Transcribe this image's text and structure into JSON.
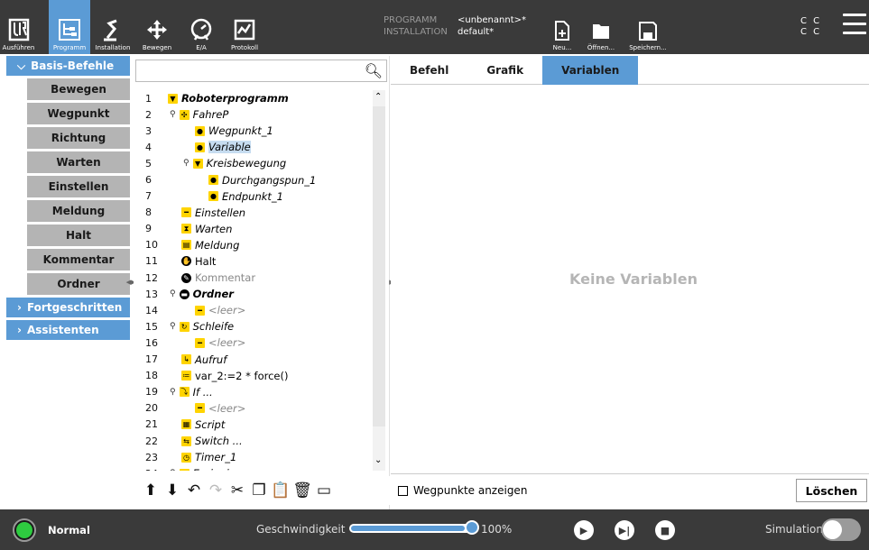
{
  "header": {
    "nav": [
      {
        "label": "Ausführen",
        "icon": "ur-logo-icon",
        "active": false
      },
      {
        "label": "Programm",
        "icon": "program-tree-icon",
        "active": true
      },
      {
        "label": "Installation",
        "icon": "robot-arm-icon",
        "active": false
      },
      {
        "label": "Bewegen",
        "icon": "move-arrows-icon",
        "active": false
      },
      {
        "label": "E/A",
        "icon": "io-gauge-icon",
        "active": false
      },
      {
        "label": "Protokoll",
        "icon": "log-graph-icon",
        "active": false
      }
    ],
    "program_key": "PROGRAMM",
    "program_value": "<unbenannt>*",
    "install_key": "INSTALLATION",
    "install_value": "default*",
    "file_buttons": [
      {
        "label": "Neu...",
        "icon": "new-file-icon"
      },
      {
        "label": "Öffnen...",
        "icon": "open-folder-icon"
      },
      {
        "label": "Speichern...",
        "icon": "save-disk-icon"
      }
    ],
    "cc_top": "C C",
    "cc_bottom": "C C"
  },
  "left": {
    "basic_section": "Basis-Befehle",
    "basic_items": [
      "Bewegen",
      "Wegpunkt",
      "Richtung",
      "Warten",
      "Einstellen",
      "Meldung",
      "Halt",
      "Kommentar",
      "Ordner"
    ],
    "advanced_section": "Fortgeschritten",
    "assistant_section": "Assistenten"
  },
  "tree": {
    "search_placeholder": "",
    "rows": [
      {
        "n": "1",
        "text": "Roboterprogramm",
        "style": "bold",
        "icon": "▼",
        "ic": "y",
        "indent": 0,
        "pin": false
      },
      {
        "n": "2",
        "text": "FahreP",
        "style": "it",
        "icon": "✣",
        "ic": "y",
        "indent": 1,
        "pin": true
      },
      {
        "n": "3",
        "text": "Wegpunkt_1",
        "style": "it",
        "icon": "●",
        "ic": "y",
        "indent": 2,
        "pin": false
      },
      {
        "n": "4",
        "text": "Variable",
        "style": "it sel",
        "icon": "●",
        "ic": "y",
        "indent": 2,
        "pin": false
      },
      {
        "n": "5",
        "text": "Kreisbewegung",
        "style": "it",
        "icon": "▼",
        "ic": "y",
        "indent": 2,
        "pin": true
      },
      {
        "n": "6",
        "text": "Durchgangspun_1",
        "style": "it",
        "icon": "●",
        "ic": "y",
        "indent": 3,
        "pin": false
      },
      {
        "n": "7",
        "text": "Endpunkt_1",
        "style": "it",
        "icon": "●",
        "ic": "y",
        "indent": 3,
        "pin": false
      },
      {
        "n": "8",
        "text": "Einstellen",
        "style": "it",
        "icon": "━",
        "ic": "y",
        "indent": 1,
        "pin": false
      },
      {
        "n": "9",
        "text": "Warten",
        "style": "it",
        "icon": "⧗",
        "ic": "y",
        "indent": 1,
        "pin": false
      },
      {
        "n": "10",
        "text": "Meldung",
        "style": "it",
        "icon": "▤",
        "ic": "y",
        "indent": 1,
        "pin": false
      },
      {
        "n": "11",
        "text": "Halt",
        "style": "",
        "icon": "✋",
        "ic": "k",
        "indent": 1,
        "pin": false
      },
      {
        "n": "12",
        "text": "Kommentar",
        "style": "gray",
        "icon": "✎",
        "ic": "k",
        "indent": 1,
        "pin": false
      },
      {
        "n": "13",
        "text": "Ordner",
        "style": "bold",
        "icon": "▬",
        "ic": "k",
        "indent": 1,
        "pin": true
      },
      {
        "n": "14",
        "text": "<leer>",
        "style": "it gray",
        "icon": "━",
        "ic": "y",
        "indent": 2,
        "pin": false
      },
      {
        "n": "15",
        "text": "Schleife",
        "style": "it",
        "icon": "↻",
        "ic": "y",
        "indent": 1,
        "pin": true
      },
      {
        "n": "16",
        "text": "<leer>",
        "style": "it gray",
        "icon": "━",
        "ic": "y",
        "indent": 2,
        "pin": false
      },
      {
        "n": "17",
        "text": "Aufruf",
        "style": "it",
        "icon": "↳",
        "ic": "y",
        "indent": 1,
        "pin": false
      },
      {
        "n": "18",
        "text": "var_2:=2 * force()",
        "style": "",
        "icon": "≔",
        "ic": "y",
        "indent": 1,
        "pin": false
      },
      {
        "n": "19",
        "text": "If ...",
        "style": "it",
        "icon": "⤵",
        "ic": "y",
        "indent": 1,
        "pin": true
      },
      {
        "n": "20",
        "text": "<leer>",
        "style": "it gray",
        "icon": "━",
        "ic": "y",
        "indent": 2,
        "pin": false
      },
      {
        "n": "21",
        "text": "Script",
        "style": "it",
        "icon": "▦",
        "ic": "y",
        "indent": 1,
        "pin": false
      },
      {
        "n": "22",
        "text": "Switch ...",
        "style": "it",
        "icon": "⇆",
        "ic": "y",
        "indent": 1,
        "pin": false
      },
      {
        "n": "23",
        "text": "Timer_1",
        "style": "it",
        "icon": "◷",
        "ic": "y",
        "indent": 1,
        "pin": false
      },
      {
        "n": "24",
        "text": "Ereignis",
        "style": "it",
        "icon": "▲",
        "ic": "y",
        "indent": 1,
        "pin": true
      }
    ],
    "toolbar": [
      {
        "icon": "arrow-up-icon",
        "glyph": "⬆",
        "dis": false
      },
      {
        "icon": "arrow-down-icon",
        "glyph": "⬇",
        "dis": false
      },
      {
        "icon": "undo-icon",
        "glyph": "↶",
        "dis": false
      },
      {
        "icon": "redo-icon",
        "glyph": "↷",
        "dis": true
      },
      {
        "icon": "cut-icon",
        "glyph": "✂",
        "dis": false
      },
      {
        "icon": "copy-icon",
        "glyph": "❐",
        "dis": false
      },
      {
        "icon": "paste-icon",
        "glyph": "📋",
        "dis": false
      },
      {
        "icon": "delete-icon",
        "glyph": "🗑",
        "dis": false
      },
      {
        "icon": "suppress-icon",
        "glyph": "▭",
        "dis": false
      }
    ]
  },
  "right": {
    "tabs": [
      {
        "label": "Befehl",
        "active": false
      },
      {
        "label": "Grafik",
        "active": false
      },
      {
        "label": "Variablen",
        "active": true
      }
    ],
    "empty_text": "Keine Variablen",
    "show_waypoints": "Wegpunkte anzeigen",
    "delete_label": "Löschen"
  },
  "footer": {
    "status": "Normal",
    "speed_label": "Geschwindigkeit",
    "speed_value": "100%",
    "speed_fraction": 1.0,
    "sim_label": "Simulation"
  },
  "colors": {
    "accent": "#5b9bd5",
    "header": "#3a3a3a",
    "yellow": "#ffd400",
    "green": "#2ecc40"
  }
}
